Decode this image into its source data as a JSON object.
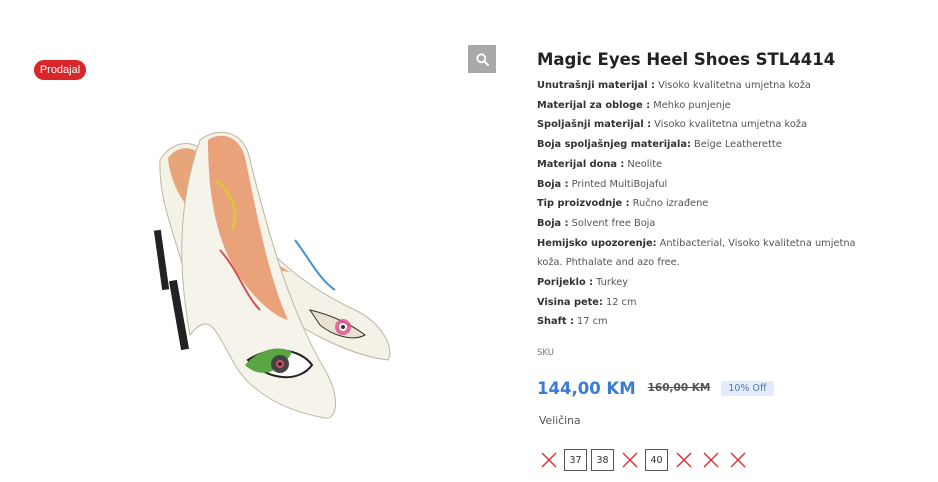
{
  "badge": {
    "label": "Prodajal"
  },
  "product": {
    "title": "Magic Eyes Heel Shoes STL4414",
    "specs": [
      {
        "label": "Unutrašnji materijal :",
        "value": " Visoko kvalitetna umjetna koža"
      },
      {
        "label": "Materijal za obloge :",
        "value": " Mehko punjenje"
      },
      {
        "label": "Spoljašnji materijal :",
        "value": " Visoko kvalitetna umjetna koža"
      },
      {
        "label": "Boja spoljašnjeg materijala:",
        "value": " Beige Leatherette"
      },
      {
        "label": "Materijal dona :",
        "value": " Neolite"
      },
      {
        "label": "Boja :",
        "value": " Printed MultiBojaful"
      },
      {
        "label": "Tip proizvodnje :",
        "value": " Ručno izrađene"
      },
      {
        "label": "Boja :",
        "value": " Solvent free Boja"
      },
      {
        "label": "Hemijsko upozorenje:",
        "value": " Antibacterial, Visoko kvalitetna umjetna koža. Phthalate and azo free."
      },
      {
        "label": "Porijeklo :",
        "value": " Turkey"
      },
      {
        "label": "Visina pete:",
        "value": " 12 cm"
      },
      {
        "label": "Shaft :",
        "value": " 17 cm"
      }
    ],
    "sku_label": "SKU",
    "price": "144,00 KM",
    "old_price": "160,00 KM",
    "discount": "10% Off",
    "size_label": "Veličina",
    "sizes": [
      {
        "label": "",
        "available": false
      },
      {
        "label": "37",
        "available": true
      },
      {
        "label": "38",
        "available": true
      },
      {
        "label": "",
        "available": false
      },
      {
        "label": "40",
        "available": true
      },
      {
        "label": "",
        "available": false
      },
      {
        "label": "",
        "available": false
      },
      {
        "label": "",
        "available": false
      }
    ]
  },
  "icons": {
    "zoom": "search-icon",
    "unavailable": "close-icon"
  },
  "colors": {
    "badge": "#d9262b",
    "price": "#3a7bd5",
    "unavailable": "#e03030"
  }
}
